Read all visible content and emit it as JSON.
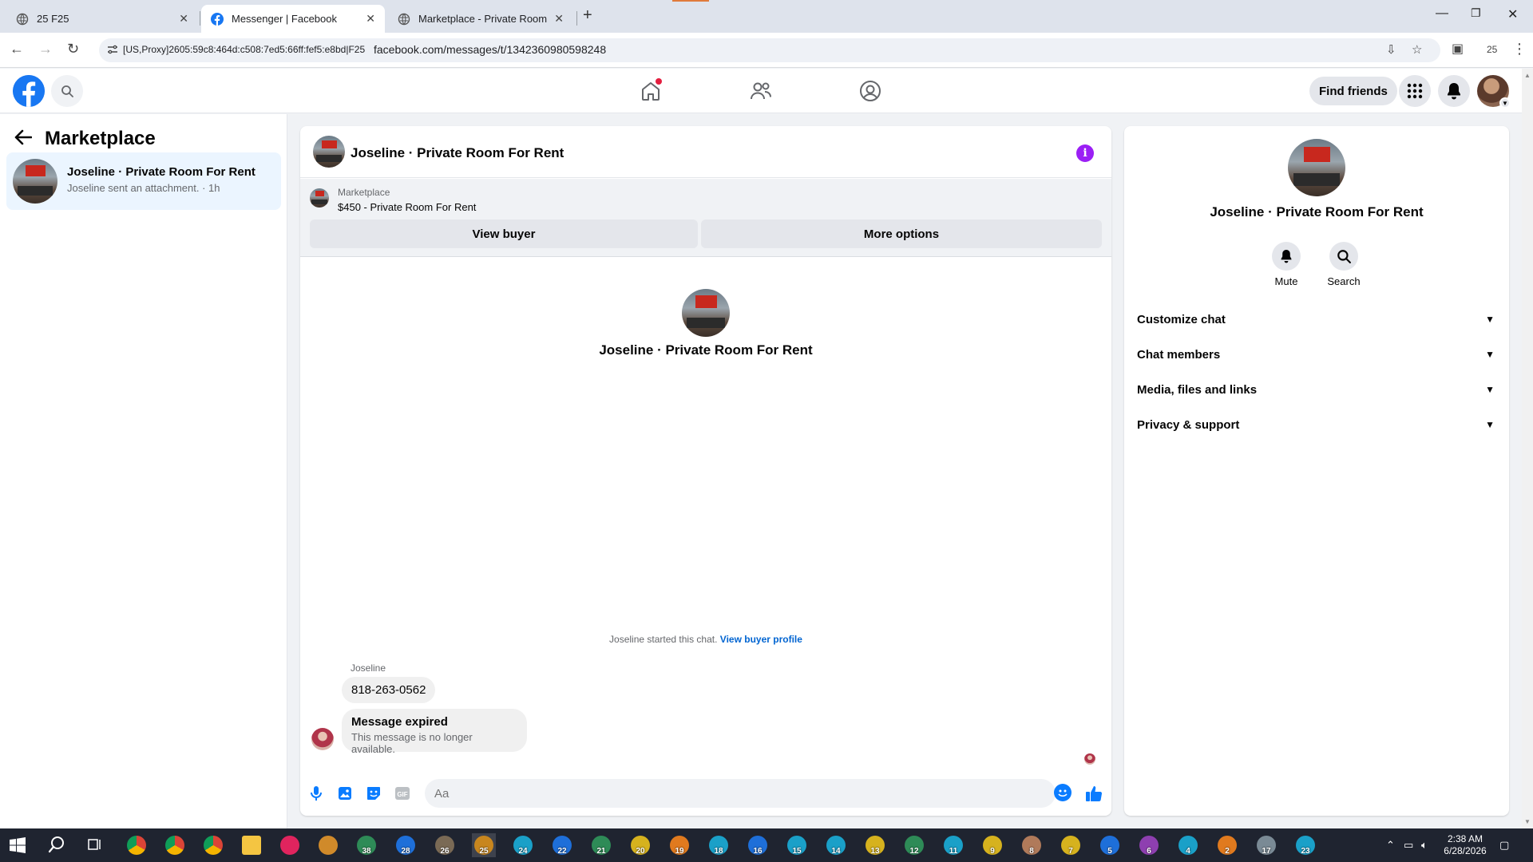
{
  "browser": {
    "tabs": [
      {
        "label": "25 F25",
        "active": false
      },
      {
        "label": "Messenger | Facebook",
        "active": true
      },
      {
        "label": "Marketplace - Private Room For Rent",
        "active": false
      }
    ],
    "omnibox": {
      "proxy_label": "[US,Proxy]2605:59c8:464d:c508:7ed5:66ff:fef5:e8bd|F25",
      "url": "facebook.com/messages/t/1342360980598248"
    },
    "profile_count": "25"
  },
  "fb_header": {
    "find_friends_label": "Find friends",
    "home_has_notification": true
  },
  "sidebar": {
    "title": "Marketplace",
    "conversations": [
      {
        "name": "Joseline · Private Room For Rent",
        "preview": "Joseline sent an attachment. · 1h",
        "selected": true
      }
    ]
  },
  "chat": {
    "title": "Joseline · Private Room For Rent",
    "marketplace_banner": {
      "label": "Marketplace",
      "listing": "$450 - Private Room For Rent",
      "view_buyer_label": "View buyer",
      "more_options_label": "More options"
    },
    "center_name": "Joseline · Private Room For Rent",
    "started_text": "Joseline started this chat.",
    "view_buyer_profile_label": "View buyer profile",
    "sender_name": "Joseline",
    "messages": [
      {
        "text": "818-263-0562"
      },
      {
        "title": "Message expired",
        "subtitle": "This message is no longer available."
      }
    ],
    "composer_placeholder": "Aa"
  },
  "info_panel": {
    "name": "Joseline · Private Room For Rent",
    "actions": [
      {
        "label": "Mute",
        "icon": "bell-icon"
      },
      {
        "label": "Search",
        "icon": "search-icon"
      }
    ],
    "sections": [
      {
        "label": "Customize chat"
      },
      {
        "label": "Chat members"
      },
      {
        "label": "Media, files and links"
      },
      {
        "label": "Privacy & support"
      }
    ]
  },
  "taskbar": {
    "app_numbers": [
      "38",
      "28",
      "26",
      "25",
      "24",
      "22",
      "21",
      "20",
      "19",
      "18",
      "16",
      "15",
      "14",
      "13",
      "12",
      "11",
      "9",
      "8",
      "7",
      "5",
      "6",
      "4",
      "2",
      "17",
      "23"
    ],
    "time": "2:38 AM",
    "date": "6/28/2026"
  },
  "colors": {
    "fb_blue": "#1877f2",
    "messenger_purple": "#9b1ff5",
    "selected_conversation": "#ebf5ff",
    "link_blue": "#0064d1"
  }
}
